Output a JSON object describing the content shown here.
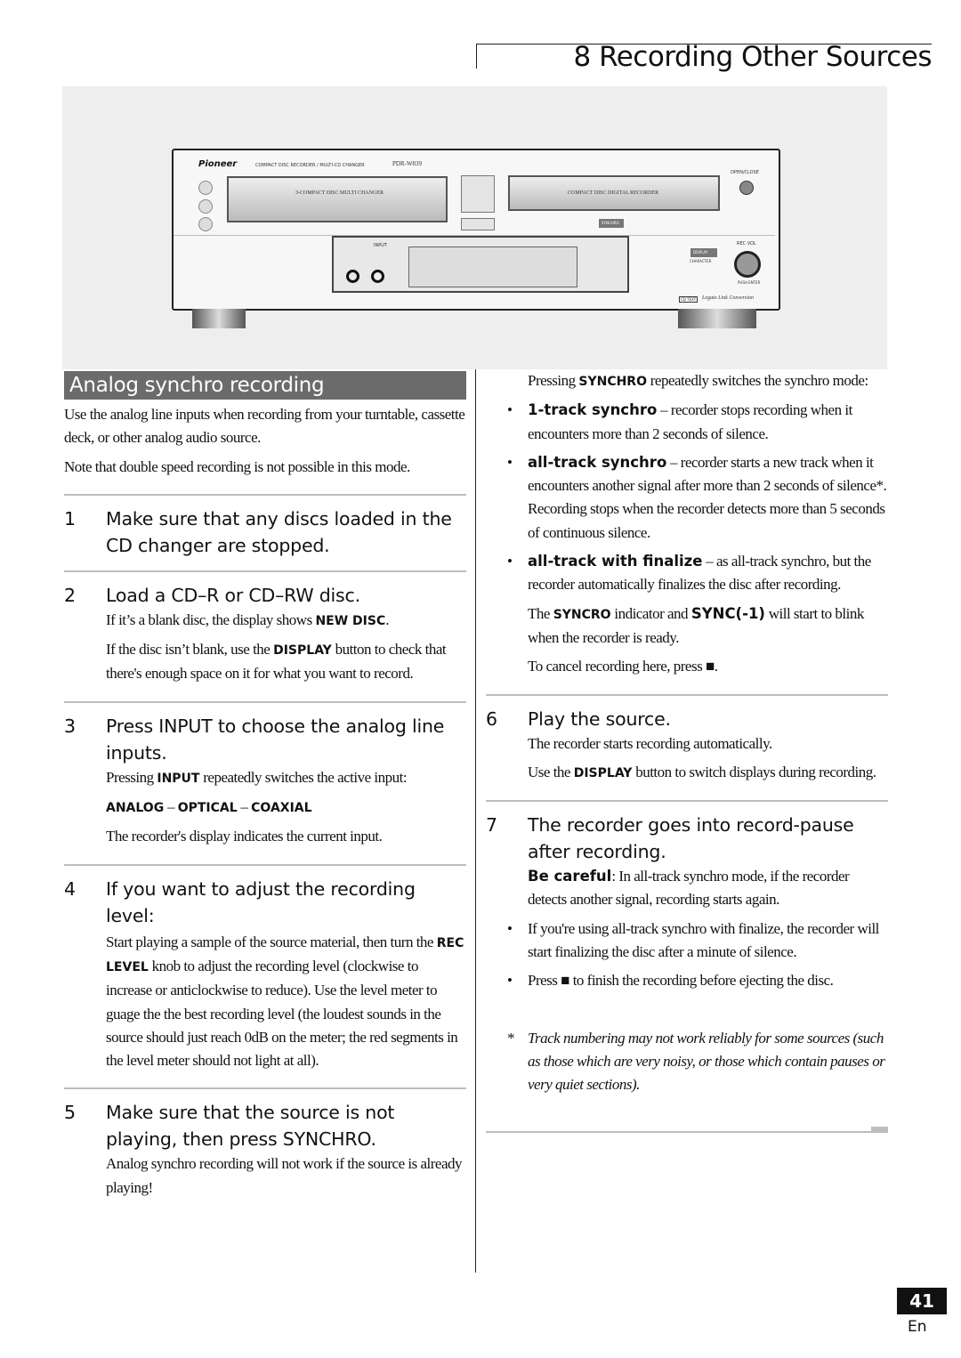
{
  "header": {
    "title": "8 Recording Other Sources"
  },
  "device": {
    "brand": "Pioneer",
    "subtitle": "COMPACT DISC RECORDER / MULTI-CD CHANGER",
    "model": "PDR-W839",
    "changer_label": "3-COMPACT DISC MULTI CHANGER",
    "recorder_label": "COMPACT DISC DIGITAL RECORDER",
    "open_close": "OPEN/CLOSE",
    "synchro": "SYNCHRO",
    "input": "INPUT",
    "display": "DISPLAY",
    "character": "CHARACTER",
    "rec_vol": "REC VOL",
    "push_enter": "PUSH ENTER",
    "cd_text": "CD TEXT",
    "legato": "Legato Link Conversion"
  },
  "left": {
    "section_title": "Analog synchro recording",
    "intro1": "Use the analog line inputs when recording from your turntable, cassette deck, or other analog audio source.",
    "intro2": "Note that double speed recording is not possible in this mode.",
    "steps": [
      {
        "num": "1",
        "title": "Make sure that any discs loaded in the CD changer are stopped."
      },
      {
        "num": "2",
        "title": "Load a CD–R or CD–RW disc.",
        "p1a": "If it’s a blank disc, the display shows ",
        "p1b": "NEW DISC",
        "p1c": ".",
        "p2a": "If the disc isn’t blank, use the ",
        "p2b": "DISPLAY",
        "p2c": " button to check that there's enough space on it for what you want to record."
      },
      {
        "num": "3",
        "title": "Press INPUT to choose the analog line inputs.",
        "p1a": "Pressing ",
        "p1b": "INPUT",
        "p1c": " repeatedly switches the active input:",
        "seq": [
          "ANALOG",
          "OPTICAL",
          "COAXIAL"
        ],
        "sep": " – ",
        "p2": "The recorder's display indicates the current input."
      },
      {
        "num": "4",
        "title": "If you want to adjust the recording level:",
        "p1a": "Start playing a sample of the source material, then turn the ",
        "p1b": "REC LEVEL",
        "p1c": " knob to adjust the recording level (clockwise to increase or anticlockwise to reduce). Use the level meter to guage the the best recording level (the loudest sounds in the source should just reach 0dB on the meter; the red segments in the level meter  should not light at all)."
      },
      {
        "num": "5",
        "title": "Make sure that the source is not playing, then press SYNCHRO.",
        "p1": "Analog synchro recording will not work if the source is already playing!"
      }
    ]
  },
  "right": {
    "p1a": "Pressing ",
    "p1b": "SYNCHRO",
    "p1c": " repeatedly switches the synchro mode:",
    "modes": [
      {
        "name": "1-track synchro",
        "desc": " – recorder stops recording when it encounters more than 2 seconds of silence."
      },
      {
        "name": "all-track synchro",
        "desc": " – recorder starts a new track when it encounters another signal after more than 2 seconds of silence*. Recording stops when the recorder detects more than 5 seconds of continuous silence."
      },
      {
        "name": "all-track with finalize",
        "desc": " – as all-track synchro, but the recorder automatically finalizes the disc after recording."
      }
    ],
    "p2a": "The ",
    "p2b": "SYNCRO",
    "p2c": " indicator and ",
    "p2d": "SYNC(-1)",
    "p2e": " will start to blink when the recorder is ready.",
    "p3a": "To cancel recording here, press ",
    "stop_symbol": "■",
    "p3c": ".",
    "step6": {
      "num": "6",
      "title": "Play the source.",
      "p1": "The recorder starts recording automatically.",
      "p2a": "Use the ",
      "p2b": "DISPLAY",
      "p2c": " button to switch displays during recording."
    },
    "step7": {
      "num": "7",
      "title": "The recorder goes into record-pause after recording.",
      "p1a": "Be careful",
      ": In all-track synchro mode, if the recorder detects another signal, recording starts again.": "",
      "p1b": ": In all-track synchro mode, if the recorder detects another signal, recording starts again.",
      "b1": "If you're using all-track synchro with finalize, the recorder will start finalizing the disc after a minute of silence.",
      "b2a": "Press ",
      "b2c": " to finish the recording before ejecting the disc."
    },
    "footnote_mark": "*",
    "footnote": "Track numbering may not work reliably for some sources (such as those which are very noisy, or those which contain pauses or very quiet sections)."
  },
  "footer": {
    "page_number": "41",
    "language": "En"
  }
}
